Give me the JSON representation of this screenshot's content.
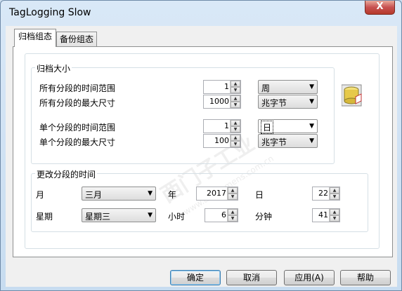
{
  "window": {
    "title": "TagLogging Slow",
    "close_symbol": "X"
  },
  "tabs": [
    {
      "label": "归档组态"
    },
    {
      "label": "备份组态"
    }
  ],
  "archive_size": {
    "group_title": "归档大小",
    "all_time_range": {
      "label": "所有分段的时间范围",
      "value": "1",
      "unit": "周"
    },
    "all_max_size": {
      "label": "所有分段的最大尺寸",
      "value": "1000",
      "unit": "兆字节"
    },
    "single_time_range": {
      "label": "单个分段的时间范围",
      "value": "1",
      "unit": "日"
    },
    "single_max_size": {
      "label": "单个分段的最大尺寸",
      "value": "100",
      "unit": "兆字节"
    }
  },
  "change_time": {
    "group_title": "更改分段的时间",
    "month": {
      "label": "月",
      "value": "三月"
    },
    "year": {
      "label": "年",
      "value": "2017"
    },
    "day": {
      "label": "日",
      "value": "22"
    },
    "weekday": {
      "label": "星期",
      "value": "星期三"
    },
    "hour": {
      "label": "小时",
      "value": "6"
    },
    "minute": {
      "label": "分钟",
      "value": "41"
    }
  },
  "buttons": {
    "ok": "确定",
    "cancel": "取消",
    "apply": "应用(A)",
    "help": "帮助"
  },
  "watermark": {
    "text": "西门子工业",
    "subtext": "www.ad.siemens.com.cn"
  },
  "icons": {
    "database": "database-icon",
    "spin_up": "▲",
    "spin_down": "▼",
    "dropdown": "▼"
  }
}
